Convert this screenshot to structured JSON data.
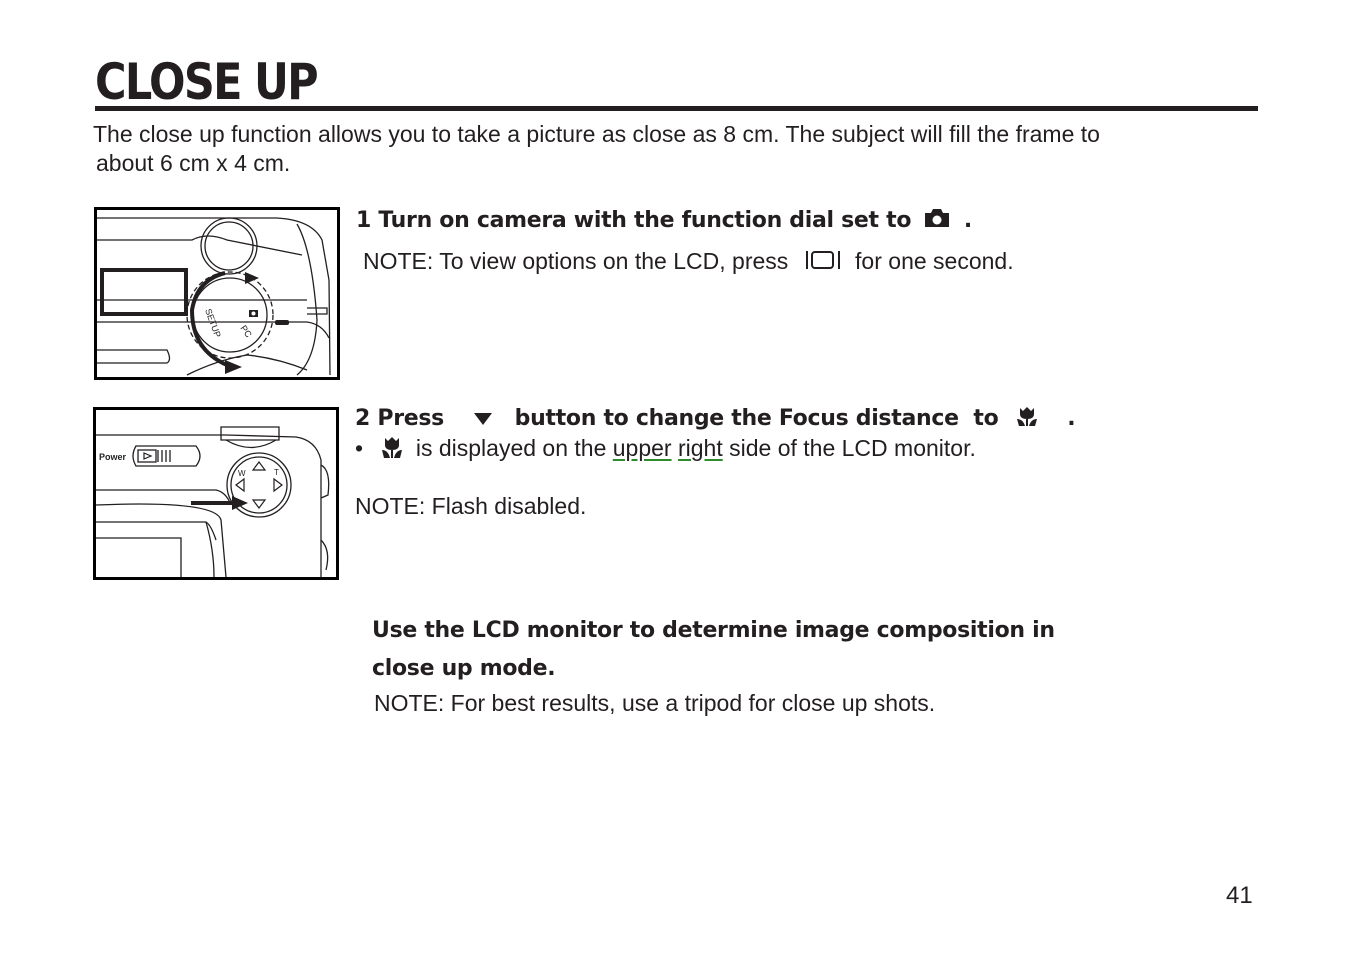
{
  "page": {
    "title": "CLOSE UP",
    "intro_line1": "The close up function allows you to take a picture as close as 8 cm. The subject will fill the frame to",
    "intro_line2": "about 6 cm x 4 cm.",
    "page_number": "41"
  },
  "step1": {
    "title": "1 Turn on camera with the function dial set to",
    "title_icon": "camera-icon",
    "title_end": ".",
    "note_prefix": "NOTE: To view options on the LCD, press",
    "note_icon": "display-button-icon",
    "note_suffix": "for one second.",
    "figure": {
      "description": "camera top view with mode dial",
      "dial_labels": [
        "SETUP",
        "PC"
      ]
    }
  },
  "step2": {
    "title_prefix": "2 Press",
    "title_icon": "down-arrow-icon",
    "title_mid": "button to change the Focus distance  to",
    "title_icon2": "macro-tulip-icon",
    "title_end": ".",
    "bullet": "•",
    "bullet_icon": "macro-tulip-icon",
    "bullet_text_1": "is displayed on the",
    "bullet_word_upper": "upper",
    "bullet_word_right": "right",
    "bullet_text_2": "side of the LCD monitor.",
    "note": "NOTE: Flash disabled.",
    "figure": {
      "description": "camera back view with power switch and 4-way controller",
      "power_label": "Power",
      "w_label": "W",
      "t_label": "T"
    }
  },
  "step3": {
    "title_line1": "Use the LCD monitor to determine image composition in",
    "title_line2": "close up mode.",
    "note": "NOTE: For best results, use a tripod for close up shots."
  },
  "colors": {
    "text": "#231f20",
    "underline": "#2e8b2e"
  }
}
